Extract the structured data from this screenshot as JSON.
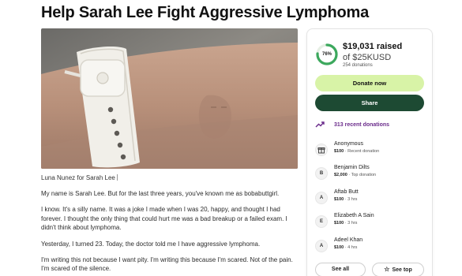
{
  "page": {
    "title": "Help Sarah Lee Fight Aggressive Lymphoma",
    "organizer": "Luna Nunez for Sarah Lee",
    "story": [
      "My name is Sarah Lee. But for the last three years, you've known me as bobabuttgirl.",
      "I know. It's a silly name. It was a joke I made when I was 20, happy, and thought I had forever. I thought the only thing that could hurt me was a bad breakup or a failed exam. I didn't think about lymphoma.",
      "Yesterday, I turned 23. Today, the doctor told me I have aggressive lymphoma.",
      "I'm writing this not because I want pity. I'm writing this because I'm scared. Not of the pain. I'm scared of the silence."
    ]
  },
  "fundraiser": {
    "progress_percent": 76,
    "progress_label": "76%",
    "raised": "$19,031 raised",
    "goal": "of $25KUSD",
    "donations_count": "254 donations",
    "donate_label": "Donate now",
    "share_label": "Share",
    "recent_label": "313 recent donations",
    "donors": [
      {
        "name": "Anonymous",
        "amount": "$100",
        "detail": " · Recent donation",
        "avatar": "gift-icon"
      },
      {
        "name": "Benjamin Dilts",
        "amount": "$2,000",
        "detail": " · Top donation",
        "avatar": "B"
      },
      {
        "name": "Aftab Butt",
        "amount": "$100",
        "detail": " · 3 hrs",
        "avatar": "A"
      },
      {
        "name": "Elizabeth A Sain",
        "amount": "$100",
        "detail": " · 3 hrs",
        "avatar": "E"
      },
      {
        "name": "Adeel Khan",
        "amount": "$100",
        "detail": " · 4 hrs",
        "avatar": "A"
      }
    ],
    "see_all_label": "See all",
    "see_top_label": "See top"
  },
  "colors": {
    "donate_bg": "#d8f3a7",
    "share_bg": "#1d4a33",
    "progress": "#3ca85d",
    "recent": "#6a2b8b"
  }
}
